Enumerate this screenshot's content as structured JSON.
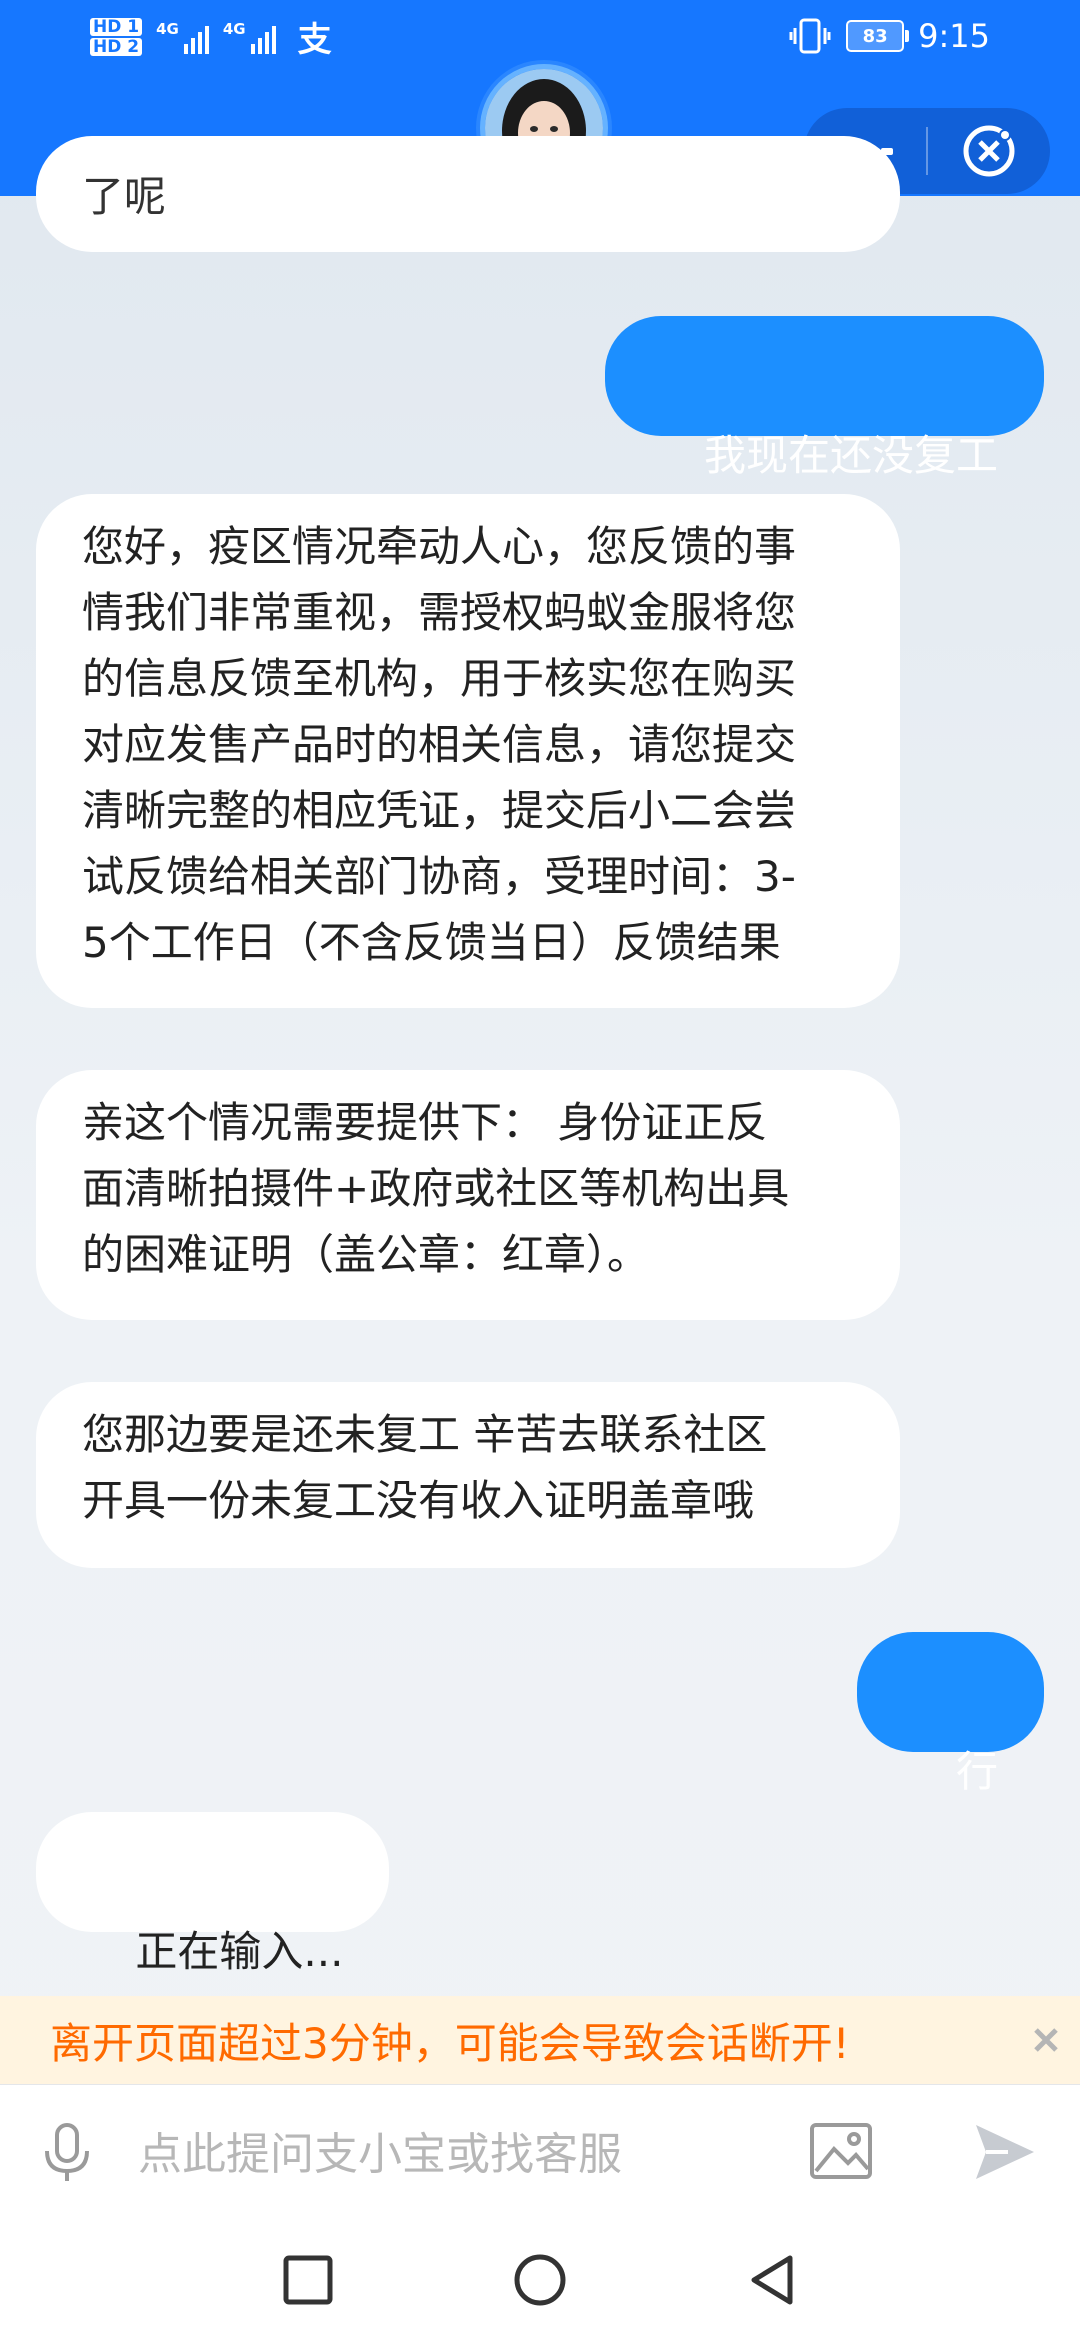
{
  "status_bar": {
    "hd1": "HD 1",
    "hd2": "HD 2",
    "net1": "4G",
    "net2": "4G",
    "alipay_icon": "alipay-icon",
    "battery": "83",
    "time": "9:15"
  },
  "header": {
    "avatar": "assistant-avatar",
    "more_icon": "more-icon",
    "close_icon": "close-miniapp-icon"
  },
  "messages": [
    {
      "from": "bot",
      "text": "了呢",
      "partial": true
    },
    {
      "from": "me",
      "text": "我现在还没复工"
    },
    {
      "from": "bot",
      "text": "您好，疫区情况牵动人心，您反馈的事\n情我们非常重视，需授权蚂蚁金服将您\n的信息反馈至机构，用于核实您在购买\n对应发售产品时的相关信息，请您提交\n清晰完整的相应凭证，提交后小二会尝\n试反馈给相关部门协商，受理时间：3-\n5个工作日（不含反馈当日）反馈结果"
    },
    {
      "from": "bot",
      "text": "亲这个情况需要提供下： 身份证正反\n面清晰拍摄件+政府或社区等机构出具\n的困难证明（盖公章：红章）。"
    },
    {
      "from": "bot",
      "text": "您那边要是还未复工 辛苦去联系社区\n开具一份未复工没有收入证明盖章哦"
    },
    {
      "from": "me",
      "text": "行"
    },
    {
      "from": "bot",
      "text": "正在输入..."
    }
  ],
  "warning": {
    "text": "离开页面超过3分钟，可能会导致会话断开!",
    "close_icon": "close-icon"
  },
  "input_bar": {
    "mic_icon": "microphone-icon",
    "placeholder": "点此提问支小宝或找客服",
    "value": "",
    "image_icon": "image-icon",
    "send_icon": "send-icon"
  },
  "nav": {
    "recent_icon": "recent-apps-icon",
    "home_icon": "home-icon",
    "back_icon": "back-icon"
  },
  "colors": {
    "brand_blue": "#1677ff",
    "user_bubble": "#1c8fff",
    "warning_text": "#ff6a00",
    "warning_bg": "#fff4e0"
  }
}
